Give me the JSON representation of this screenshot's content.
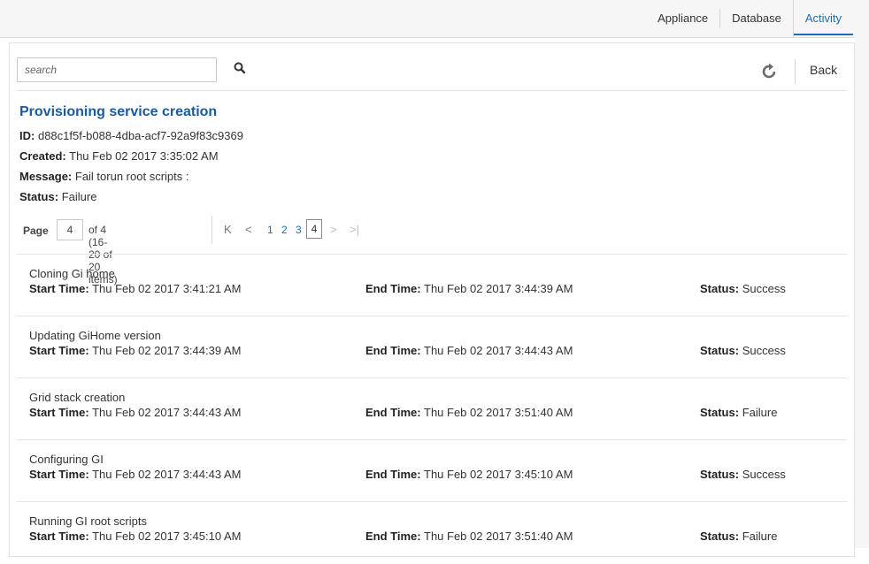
{
  "nav": {
    "tabs": [
      {
        "label": "Appliance",
        "active": false
      },
      {
        "label": "Database",
        "active": false
      },
      {
        "label": "Activity",
        "active": true
      }
    ]
  },
  "toolbar": {
    "search_placeholder": "search",
    "search_icon": "search-icon",
    "refresh_icon": "refresh-icon",
    "back_label": "Back"
  },
  "job": {
    "title": "Provisioning service creation",
    "id_label": "ID:",
    "id_value": "d88c1f5f-b088-4dba-acf7-92a9f83c9369",
    "created_label": "Created:",
    "created_value": "Thu Feb 02 2017 3:35:02 AM",
    "message_label": "Message:",
    "message_value": "Fail torun root scripts :",
    "status_label": "Status:",
    "status_value": "Failure"
  },
  "pager": {
    "page_label": "Page",
    "current_page": "4",
    "summary": "of 4 (16-20 of 20 items)",
    "first": "K",
    "prev": "<",
    "next": ">",
    "last": ">|",
    "pages": [
      "1",
      "2",
      "3",
      "4"
    ]
  },
  "tasks": {
    "start_label": "Start Time:",
    "end_label": "End Time:",
    "status_label": "Status:",
    "rows": [
      {
        "name": "Cloning Gi home",
        "start": "Thu Feb 02 2017 3:41:21 AM",
        "end": "Thu Feb 02 2017 3:44:39 AM",
        "status": "Success"
      },
      {
        "name": "Updating GiHome version",
        "start": "Thu Feb 02 2017 3:44:39 AM",
        "end": "Thu Feb 02 2017 3:44:43 AM",
        "status": "Success"
      },
      {
        "name": "Grid stack creation",
        "start": "Thu Feb 02 2017 3:44:43 AM",
        "end": "Thu Feb 02 2017 3:51:40 AM",
        "status": "Failure"
      },
      {
        "name": "Configuring GI",
        "start": "Thu Feb 02 2017 3:44:43 AM",
        "end": "Thu Feb 02 2017 3:45:10 AM",
        "status": "Success"
      },
      {
        "name": "Running GI root scripts",
        "start": "Thu Feb 02 2017 3:45:10 AM",
        "end": "Thu Feb 02 2017 3:51:40 AM",
        "status": "Failure"
      }
    ]
  },
  "colors": {
    "accent": "#1a6fb5",
    "title": "#1a5aa0"
  }
}
